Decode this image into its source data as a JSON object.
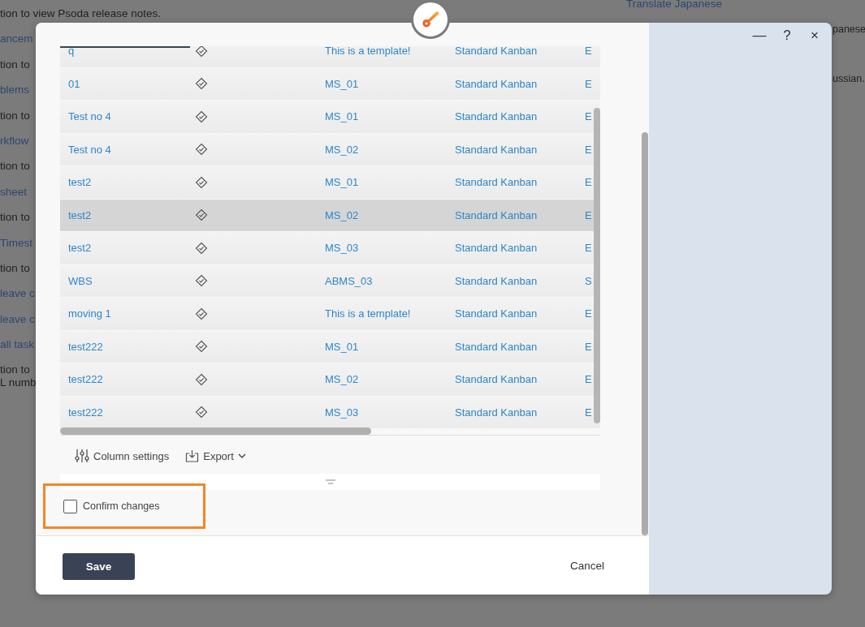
{
  "background_page": {
    "left_lines": [
      {
        "text": "tion to view Psoda release notes.",
        "kind": "text"
      },
      {
        "text": "ancem",
        "kind": "link"
      },
      {
        "text": "tion to",
        "kind": "text"
      },
      {
        "text": "blems",
        "kind": "link"
      },
      {
        "text": "tion to",
        "kind": "text"
      },
      {
        "text": "rkflow",
        "kind": "link"
      },
      {
        "text": "tion to",
        "kind": "text"
      },
      {
        "text": "sheet",
        "kind": "link"
      },
      {
        "text": "tion to",
        "kind": "text"
      },
      {
        "text": "Timest",
        "kind": "link"
      },
      {
        "text": "tion to",
        "kind": "text"
      },
      {
        "text": "leave c",
        "kind": "link"
      },
      {
        "text": "leave c",
        "kind": "link"
      },
      {
        "text": "all task",
        "kind": "link"
      },
      {
        "text": "tion to",
        "kind": "text"
      },
      {
        "text": "L numb",
        "kind": "text"
      }
    ],
    "right_lines": [
      {
        "text": "Translate Japanese",
        "kind": "link"
      },
      {
        "text": "panese",
        "kind": "text"
      },
      {
        "text": "ussian.",
        "kind": "text"
      }
    ]
  },
  "dialog": {
    "window_buttons": [
      "—",
      "?",
      "×"
    ],
    "table": {
      "rows": [
        {
          "name": "q",
          "milestone": "This is a template!",
          "template": "Standard Kanban",
          "column_5": "E",
          "selected": false
        },
        {
          "name": "01",
          "milestone": "MS_01",
          "template": "Standard Kanban",
          "column_5": "E",
          "selected": false
        },
        {
          "name": "Test no 4",
          "milestone": "MS_01",
          "template": "Standard Kanban",
          "column_5": "E",
          "selected": false
        },
        {
          "name": "Test no 4",
          "milestone": "MS_02",
          "template": "Standard Kanban",
          "column_5": "E",
          "selected": false
        },
        {
          "name": "test2",
          "milestone": "MS_01",
          "template": "Standard Kanban",
          "column_5": "E",
          "selected": false
        },
        {
          "name": "test2",
          "milestone": "MS_02",
          "template": "Standard Kanban",
          "column_5": "E",
          "selected": true
        },
        {
          "name": "test2",
          "milestone": "MS_03",
          "template": "Standard Kanban",
          "column_5": "E",
          "selected": false
        },
        {
          "name": "WBS",
          "milestone": "ABMS_03",
          "template": "Standard Kanban",
          "column_5": "S",
          "selected": false
        },
        {
          "name": "moving 1",
          "milestone": "This is a template!",
          "template": "Standard Kanban",
          "column_5": "E",
          "selected": false
        },
        {
          "name": "test222",
          "milestone": "MS_01",
          "template": "Standard Kanban",
          "column_5": "E",
          "selected": false
        },
        {
          "name": "test222",
          "milestone": "MS_02",
          "template": "Standard Kanban",
          "column_5": "E",
          "selected": false
        },
        {
          "name": "test222",
          "milestone": "MS_03",
          "template": "Standard Kanban",
          "column_5": "E",
          "selected": false
        }
      ]
    },
    "toolbar": {
      "column_settings": "Column settings",
      "export": "Export"
    },
    "confirm": {
      "label": "Confirm changes",
      "checked": false
    },
    "buttons": {
      "save": "Save",
      "cancel": "Cancel"
    }
  }
}
